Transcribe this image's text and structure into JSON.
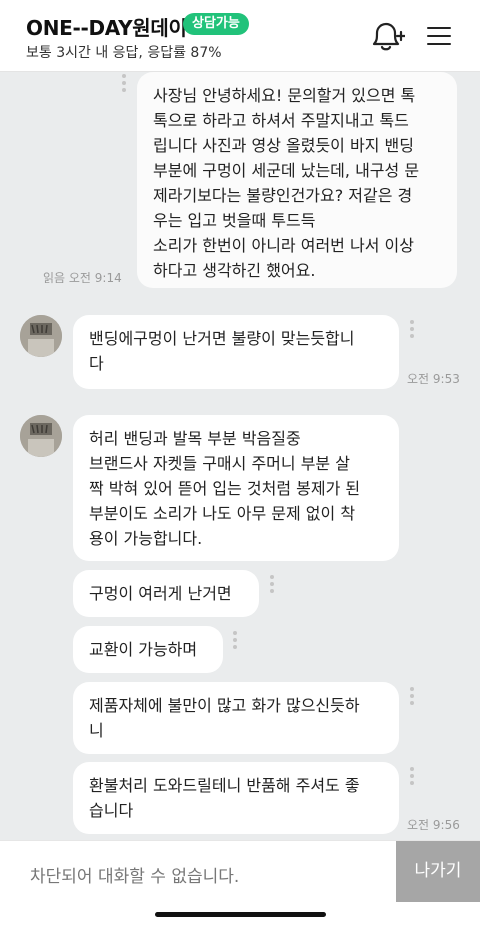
{
  "header": {
    "title": "ONE--DAY원데이",
    "badge": "상담가능",
    "subtitle": "보통 3시간 내 응답, 응답률 87%",
    "bell_icon": "bell-plus-icon",
    "menu_icon": "hamburger-menu-icon"
  },
  "messages": {
    "m1": {
      "lines": [
        "사장님 안녕하세요! 문의할거 있으면 톡",
        "톡으로 하라고 하셔서 주말지내고 톡드",
        "립니다 사진과 영상 올렸듯이 바지 밴딩",
        "부분에 구멍이 세군데 났는데, 내구성 문",
        "제라기보다는 불량인건가요? 저같은 경",
        "우는 입고 벗을때 투드득",
        "소리가 한번이 아니라 여러번 나서 이상",
        "하다고 생각하긴 했어요."
      ],
      "meta": "읽음 오전 9:14"
    },
    "m2": {
      "lines": [
        "밴딩에구멍이 난거면 불량이 맞는듯합니",
        "다"
      ],
      "time": "오전 9:53"
    },
    "m3": {
      "lines": [
        "허리 밴딩과 발목 부분 박음질중",
        "브랜드사 자켓들 구매시 주머니 부분 살",
        "짝 박혀 있어 뜯어 입는 것처럼 봉제가 된",
        "부분이도 소리가 나도 아무 문제 없이 착",
        "용이 가능합니다."
      ]
    },
    "m4": {
      "lines": [
        "구멍이 여러게 난거면"
      ]
    },
    "m5": {
      "lines": [
        "교환이 가능하며"
      ]
    },
    "m6": {
      "lines": [
        "제품자체에 불만이 많고 화가 많으신듯하",
        "니"
      ]
    },
    "m7": {
      "lines": [
        "환불처리 도와드릴테니 반품해 주셔도 좋",
        "습니다"
      ],
      "time": "오전 9:56"
    }
  },
  "footer": {
    "blocked_text": "차단되어 대화할 수 없습니다.",
    "exit_label": "나가기"
  },
  "colors": {
    "badge": "#21c27a",
    "background": "#eaeced",
    "exit_button": "#a6a6a6"
  }
}
